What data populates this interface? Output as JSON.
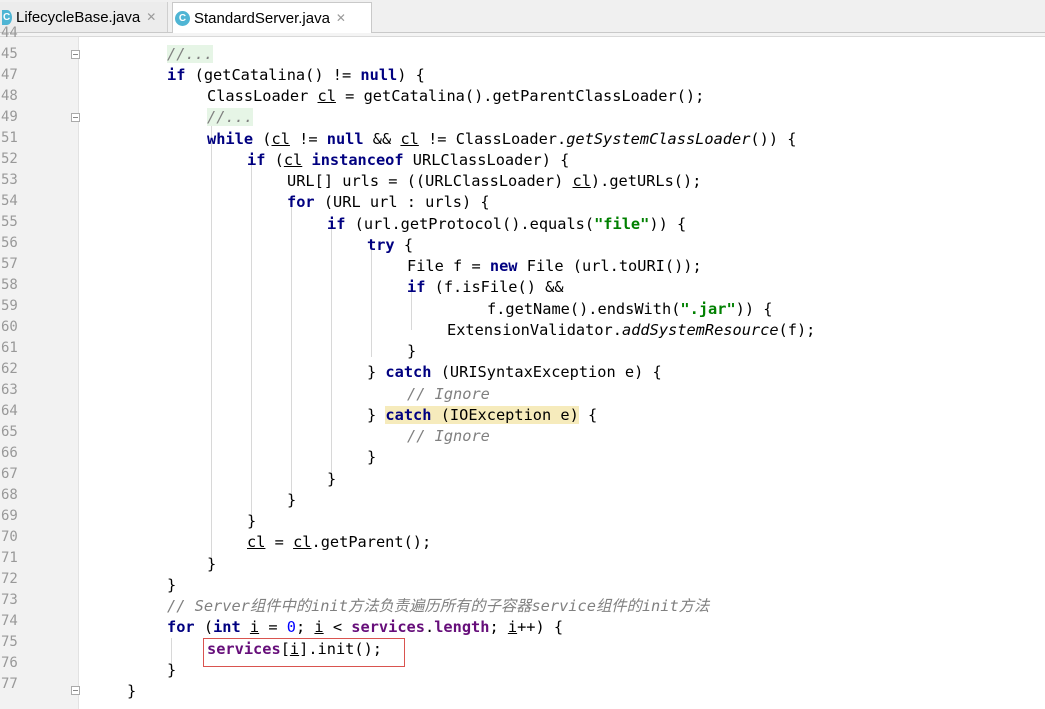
{
  "tabs": [
    {
      "label": "LifecycleBase.java",
      "icon": "java-class-icon",
      "active": false
    },
    {
      "label": "StandardServer.java",
      "icon": "java-class-icon",
      "active": true
    }
  ],
  "line_numbers": [
    "44",
    "45",
    "47",
    "48",
    "49",
    "51",
    "52",
    "53",
    "54",
    "55",
    "56",
    "57",
    "58",
    "59",
    "60",
    "61",
    "62",
    "63",
    "64",
    "65",
    "66",
    "67",
    "68",
    "69",
    "70",
    "71",
    "72",
    "73",
    "74",
    "75",
    "76",
    "77"
  ],
  "code": [
    "//...",
    "if (getCatalina() != null) {",
    "ClassLoader cl = getCatalina().getParentClassLoader();",
    "//...",
    "while (cl != null && cl != ClassLoader.getSystemClassLoader()) {",
    "if (cl instanceof URLClassLoader) {",
    "URL[] urls = ((URLClassLoader) cl).getURLs();",
    "for (URL url : urls) {",
    "if (url.getProtocol().equals(\"file\")) {",
    "try {",
    "File f = new File (url.toURI());",
    "if (f.isFile() &&",
    "f.getName().endsWith(\".jar\")) {",
    "ExtensionValidator.addSystemResource(f);",
    "}",
    "} catch (URISyntaxException e) {",
    "// Ignore",
    "} catch (IOException e) {",
    "// Ignore",
    "}",
    "}",
    "}",
    "}",
    "cl = cl.getParent();",
    "}",
    "}",
    "// Server组件中的init方法负责遍历所有的子容器service组件的init方法",
    "for (int i = 0; i < services.length; i++) {",
    "services[i].init();",
    "}",
    "}"
  ],
  "colors": {
    "keyword": "#000080",
    "string": "#008000",
    "comment": "#808080",
    "field": "#660e7a",
    "highlight_box": "#d9534f"
  }
}
